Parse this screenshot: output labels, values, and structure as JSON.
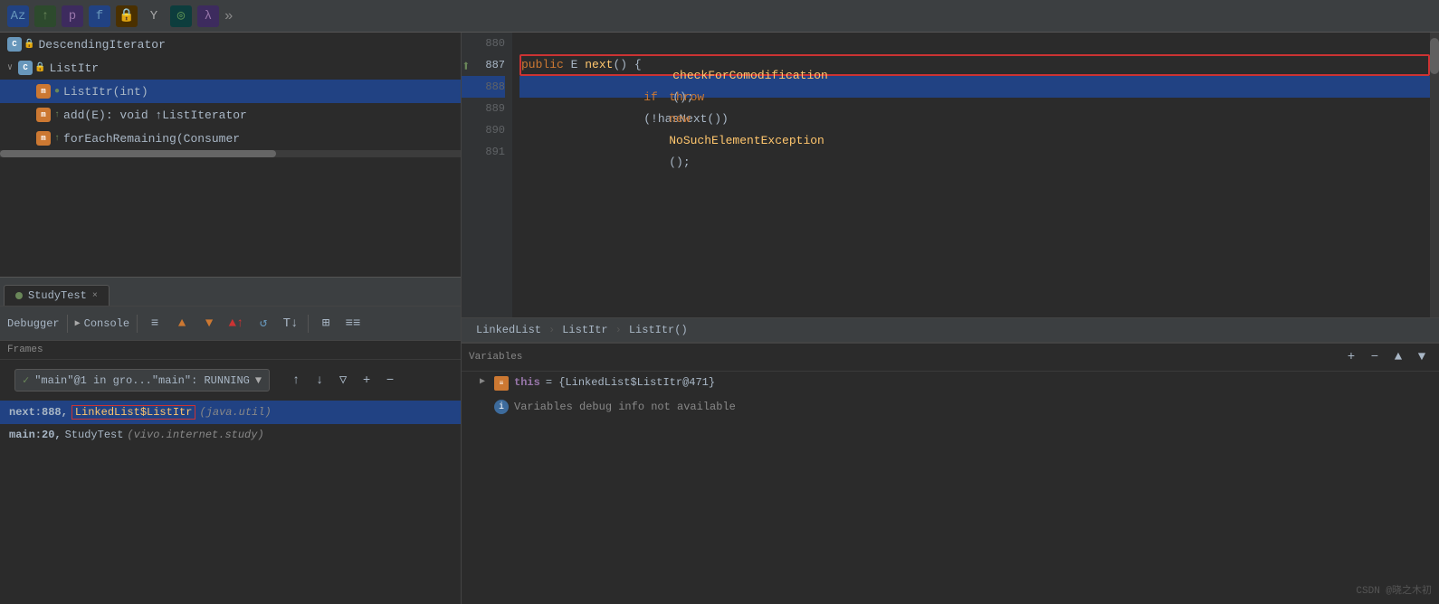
{
  "toolbar": {
    "icons": [
      "Az",
      "↑",
      "p",
      "f",
      "🔒",
      "Y",
      "◎",
      "λ"
    ],
    "more": "»"
  },
  "tree": {
    "items": [
      {
        "level": 0,
        "type": "class",
        "label": "DescendingIterator",
        "icon": "C",
        "lock": true,
        "selected": false
      },
      {
        "level": 0,
        "type": "class",
        "label": "ListItr",
        "icon": "C",
        "lock": true,
        "selected": false,
        "chevron": "∨"
      },
      {
        "level": 2,
        "type": "method",
        "label": "ListItr(int)",
        "icon": "m",
        "badge": "circle",
        "selected": true
      },
      {
        "level": 2,
        "type": "method",
        "label": "add(E): void  ↑ListIterator",
        "icon": "m",
        "badge": "arrow",
        "selected": false
      },
      {
        "level": 2,
        "type": "method",
        "label": "forEachRemaining(Consumer",
        "icon": "m",
        "badge": "arrow",
        "selected": false
      }
    ]
  },
  "code": {
    "lines": [
      {
        "num": "880",
        "content": ""
      },
      {
        "num": "887",
        "content": "    public E next() {",
        "highlighted": false,
        "outlined": true,
        "arrow": true
      },
      {
        "num": "888",
        "content": "        checkForComodification();",
        "highlighted": true
      },
      {
        "num": "889",
        "content": "        if (!hasNext())"
      },
      {
        "num": "890",
        "content": "            throw new NoSuchElementException();"
      },
      {
        "num": "891",
        "content": ""
      }
    ],
    "breadcrumb": [
      "LinkedList",
      "ListItr",
      "ListItr()"
    ]
  },
  "debugger": {
    "tab_label": "StudyTest",
    "tab_close": "×",
    "toolbar": {
      "debugger_label": "Debugger",
      "console_label": "Console",
      "icons": [
        "≡",
        "▲",
        "▼",
        "▼↓",
        "▲↑",
        "↺",
        "T↓",
        "⊞",
        "≡≡"
      ]
    },
    "frames_label": "Frames",
    "dropdown": {
      "check": "✓",
      "label": "\"main\"@1 in gro...\"main\": RUNNING",
      "arrow": "▼"
    },
    "frame_items": [
      {
        "loc": "next:888,",
        "class_text": "LinkedList$ListItr",
        "class_italic": " (java.util)",
        "highlighted": true,
        "class_outlined": true
      },
      {
        "loc": "main:20,",
        "class_text": "StudyTest",
        "class_italic": " (vivo.internet.study)",
        "highlighted": false,
        "class_outlined": false
      }
    ],
    "nav_icons": [
      "↑",
      "↓",
      "▽"
    ]
  },
  "variables": {
    "label": "Variables",
    "items": [
      {
        "name": "this",
        "value": "= {LinkedList$ListItr@471}",
        "expand": true
      },
      {
        "info": "Variables debug info not available"
      }
    ],
    "toolbar_icons": [
      "+",
      "−",
      "▲",
      "▼"
    ]
  },
  "watermark": "CSDN @晓之木初"
}
